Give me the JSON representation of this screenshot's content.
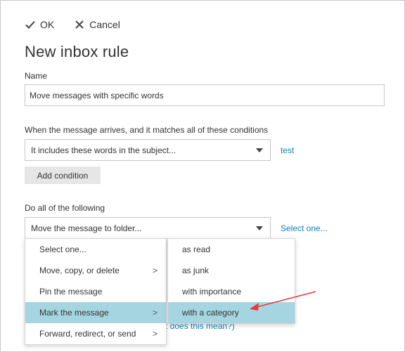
{
  "toolbar": {
    "ok_label": "OK",
    "cancel_label": "Cancel"
  },
  "page": {
    "title": "New inbox rule"
  },
  "name_field": {
    "label": "Name",
    "value": "Move messages with specific words"
  },
  "conditions": {
    "label": "When the message arrives, and it matches all of these conditions",
    "selected": "It includes these words in the subject...",
    "test_link": "test",
    "add_condition_label": "Add condition"
  },
  "actions": {
    "label": "Do all of the following",
    "selected": "Move the message to folder...",
    "select_link": "Select one..."
  },
  "action_menu": {
    "items": [
      {
        "label": "Select one...",
        "has_submenu": false
      },
      {
        "label": "Move, copy, or delete",
        "has_submenu": true,
        "chevron": ">"
      },
      {
        "label": "Pin the message",
        "has_submenu": false
      },
      {
        "label": "Mark the message",
        "has_submenu": true,
        "chevron": ">"
      },
      {
        "label": "Forward, redirect, or send",
        "has_submenu": true,
        "chevron": ">"
      }
    ],
    "active_index": 3
  },
  "mark_submenu": {
    "items": [
      {
        "label": "as read"
      },
      {
        "label": "as junk"
      },
      {
        "label": "with importance"
      },
      {
        "label": "with a category"
      }
    ],
    "active_index": 3
  },
  "background_link": {
    "label": "t does this mean?)"
  },
  "colors": {
    "link": "#0f7fb8",
    "highlight": "#a6d5e2",
    "annotation_arrow": "#e8383d"
  }
}
